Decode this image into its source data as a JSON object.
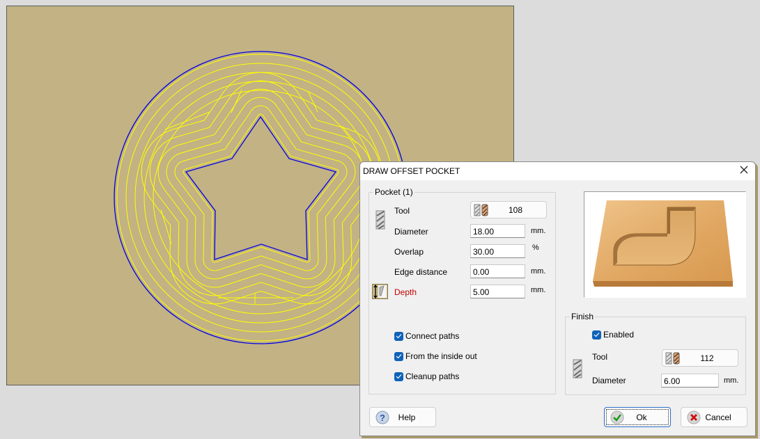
{
  "canvas": {
    "background_color": "#c2b284",
    "boundary_color": "#0000e0",
    "toolpath_color": "#ffff00",
    "shapes": [
      "outer-circle",
      "inner-star"
    ]
  },
  "dialog": {
    "title": "DRAW OFFSET POCKET",
    "close_icon": "close-icon",
    "pocket": {
      "legend": "Pocket (1)",
      "tool_label": "Tool",
      "tool_number": "108",
      "diameter_label": "Diameter",
      "diameter_value": "18.00",
      "diameter_unit": "mm.",
      "overlap_label": "Overlap",
      "overlap_value": "30.00",
      "overlap_unit": "%",
      "edge_distance_label": "Edge distance",
      "edge_distance_value": "0.00",
      "edge_distance_unit": "mm.",
      "depth_label": "Depth",
      "depth_value": "5.00",
      "depth_unit": "mm.",
      "options": [
        {
          "label": "Connect paths",
          "checked": true
        },
        {
          "label": "From the inside out",
          "checked": true
        },
        {
          "label": "Cleanup paths",
          "checked": true
        }
      ]
    },
    "finish": {
      "legend": "Finish",
      "enabled_label": "Enabled",
      "enabled_checked": true,
      "tool_label": "Tool",
      "tool_number": "112",
      "diameter_label": "Diameter",
      "diameter_value": "6.00",
      "diameter_unit": "mm."
    },
    "buttons": {
      "help": "Help",
      "ok": "Ok",
      "cancel": "Cancel"
    }
  }
}
